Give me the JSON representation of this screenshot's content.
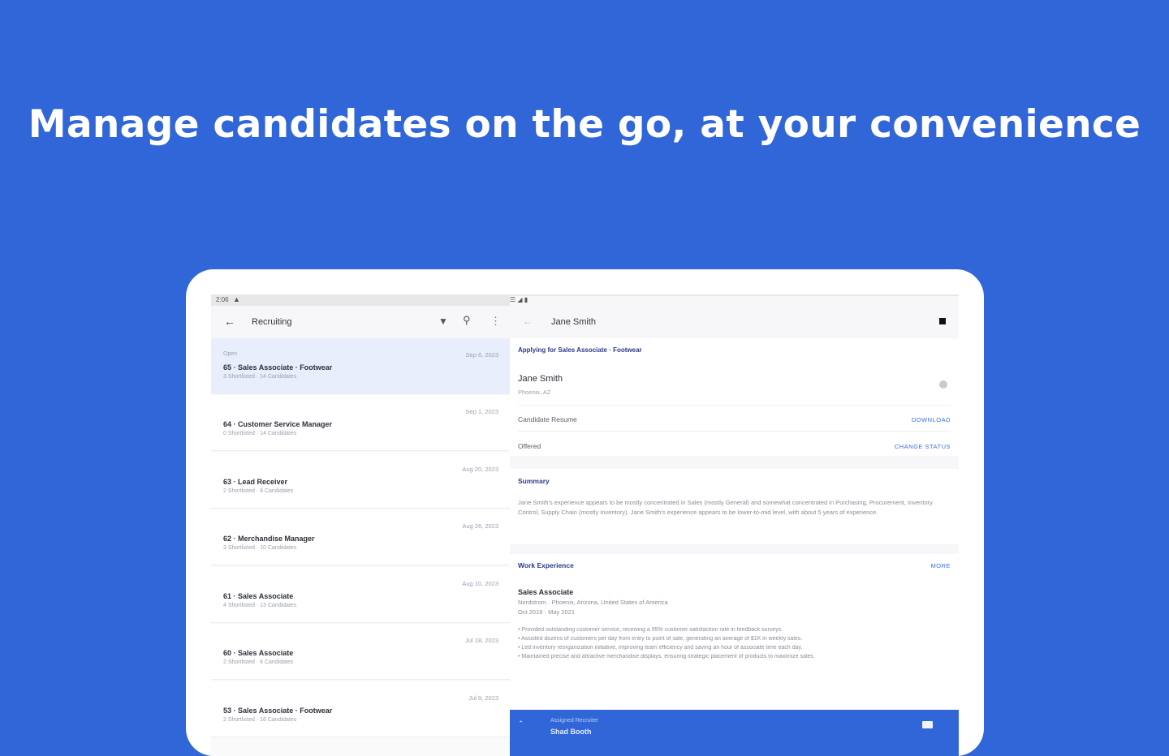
{
  "headline": "Manage candidates on the go, at your convenience",
  "statusbar": {
    "time": "2:06",
    "right_icons": "☰ ◢ ▮"
  },
  "left_pane": {
    "back_icon": "arrow-left-icon",
    "title": "Recruiting",
    "jobs": [
      {
        "status": "Open",
        "date": "Sep 6, 2023",
        "name": "65 · Sales Associate · Footwear",
        "meta": "3 Shortlisted · 14 Candidates"
      },
      {
        "status": "",
        "date": "Sep 1, 2023",
        "name": "64 · Customer Service Manager",
        "meta": "0 Shortlisted · 14 Candidates"
      },
      {
        "status": "",
        "date": "Aug 20, 2023",
        "name": "63 · Lead Receiver",
        "meta": "2 Shortlisted · 8 Candidates"
      },
      {
        "status": "",
        "date": "Aug 26, 2023",
        "name": "62 · Merchandise Manager",
        "meta": "3 Shortlisted · 10 Candidates"
      },
      {
        "status": "",
        "date": "Aug 10, 2023",
        "name": "61 · Sales Associate",
        "meta": "4 Shortlisted · 13 Candidates"
      },
      {
        "status": "",
        "date": "Jul 18, 2023",
        "name": "60 · Sales Associate",
        "meta": "2 Shortlisted · 6 Candidates"
      },
      {
        "status": "",
        "date": "Jul 9, 2023",
        "name": "53 · Sales Associate · Footwear",
        "meta": "2 Shortlisted · 16 Candidates"
      }
    ]
  },
  "right_pane": {
    "candidate_name_header": "Jane Smith",
    "applying_for": "Applying for Sales Associate · Footwear",
    "candidate_name": "Jane Smith",
    "candidate_location": "Phoenix, AZ",
    "resume_label": "Candidate Resume",
    "resume_action": "DOWNLOAD",
    "status_label": "Offered",
    "status_action": "CHANGE STATUS",
    "summary_title": "Summary",
    "summary_text": "Jane Smith's experience appears to be mostly concentrated in Sales (mostly General) and somewhat concentrated in Purchasing, Procurement, Inventory Control, Supply Chain (mostly Inventory). Jane Smith's experience appears to be lower-to-mid level, with about 5 years of experience.",
    "work_title": "Work Experience",
    "work_action": "MORE",
    "exp_title": "Sales Associate",
    "exp_company": "Nordstrom · Phoenix, Arizona, United States of America",
    "exp_dates": "Oct 2019 · May 2021",
    "bullets": [
      "• Provided outstanding customer service, receiving a 95% customer satisfaction rate in feedback surveys.",
      "• Assisted dozens of customers per day from entry to point of sale, generating an average of $1K in weekly sales.",
      "• Led inventory reorganization initiative, improving team efficiency and saving an hour of associate time each day.",
      "• Maintained precise and attractive merchandise displays, ensuring strategic placement of products to maximize sales."
    ],
    "recruiter_label": "Assigned Recruiter",
    "recruiter_name": "Shad Booth"
  },
  "colors": {
    "background": "#3066d8",
    "selected_row": "#e8eefb",
    "accent_text": "#2b3a8c",
    "link": "#3b6fe0"
  }
}
